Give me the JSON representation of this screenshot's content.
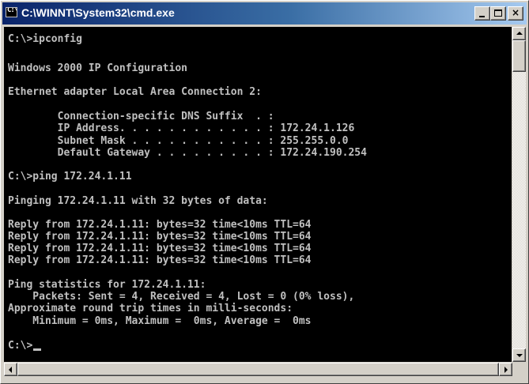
{
  "window": {
    "title": "C:\\WINNT\\System32\\cmd.exe",
    "icon_text": "C:\\",
    "buttons": {
      "minimize": "minimize-icon",
      "maximize": "maximize-icon",
      "close_label": "×"
    }
  },
  "colors": {
    "console_background": "#000000",
    "console_text": "#c0c0c0",
    "title_gradient_start": "#0a246a",
    "title_gradient_end": "#a6caf0"
  },
  "console": {
    "lines": [
      "C:\\>ipconfig",
      "Windows 2000 IP Configuration",
      "Ethernet adapter Local Area Connection 2:",
      "        Connection-specific DNS Suffix  . :",
      "        IP Address. . . . . . . . . . . . : 172.24.1.126",
      "        Subnet Mask . . . . . . . . . . . : 255.255.0.0",
      "        Default Gateway . . . . . . . . . : 172.24.190.254",
      "C:\\>ping 172.24.1.11",
      "Pinging 172.24.1.11 with 32 bytes of data:",
      "Reply from 172.24.1.11: bytes=32 time<10ms TTL=64",
      "Reply from 172.24.1.11: bytes=32 time<10ms TTL=64",
      "Reply from 172.24.1.11: bytes=32 time<10ms TTL=64",
      "Reply from 172.24.1.11: bytes=32 time<10ms TTL=64",
      "Ping statistics for 172.24.1.11:",
      "    Packets: Sent = 4, Received = 4, Lost = 0 (0% loss),",
      "Approximate round trip times in milli-seconds:",
      "    Minimum = 0ms, Maximum =  0ms, Average =  0ms",
      "C:\\>"
    ]
  },
  "scrollbars": {
    "up_arrow": "scroll-up-arrow-icon",
    "down_arrow": "scroll-down-arrow-icon",
    "left_arrow": "scroll-left-arrow-icon",
    "right_arrow": "scroll-right-arrow-icon"
  }
}
